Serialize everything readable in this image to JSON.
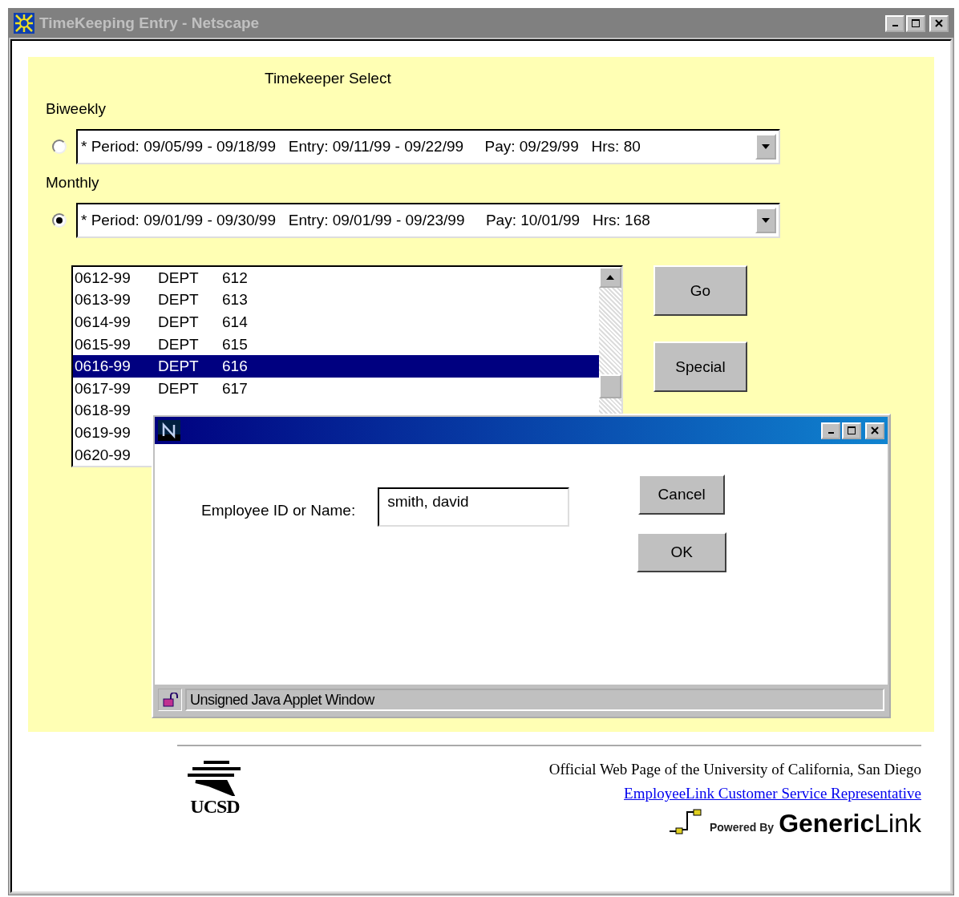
{
  "window": {
    "title": "TimeKeeping Entry - Netscape"
  },
  "page": {
    "heading": "Timekeeper Select",
    "periods": [
      {
        "label": "Biweekly",
        "selected": false,
        "value": "* Period: 09/05/99 - 09/18/99   Entry: 09/11/99 - 09/22/99     Pay: 09/29/99   Hrs: 80"
      },
      {
        "label": "Monthly",
        "selected": true,
        "value": "* Period: 09/01/99 - 09/30/99   Entry: 09/01/99 - 09/23/99     Pay: 10/01/99   Hrs: 168"
      }
    ],
    "departments": [
      {
        "code": "0612-99",
        "dept": "DEPT",
        "number": "612",
        "selected": false
      },
      {
        "code": "0613-99",
        "dept": "DEPT",
        "number": "613",
        "selected": false
      },
      {
        "code": "0614-99",
        "dept": "DEPT",
        "number": "614",
        "selected": false
      },
      {
        "code": "0615-99",
        "dept": "DEPT",
        "number": "615",
        "selected": false
      },
      {
        "code": "0616-99",
        "dept": "DEPT",
        "number": "616",
        "selected": true
      },
      {
        "code": "0617-99",
        "dept": "DEPT",
        "number": "617",
        "selected": false
      },
      {
        "code": "0618-99",
        "selected": false
      },
      {
        "code": "0619-99",
        "selected": false
      },
      {
        "code": "0620-99",
        "selected": false
      }
    ],
    "buttons": [
      "Go",
      "Special"
    ]
  },
  "dialog": {
    "label": "Employee ID or Name:",
    "value": "smith, david",
    "buttons": [
      "Cancel",
      "OK"
    ],
    "status": "Unsigned Java Applet Window"
  },
  "footer": {
    "official": "Official Web Page of the University of California, San Diego",
    "logo": "UCSD",
    "link": "EmployeeLink Customer Service Representative",
    "powered": "Powered By",
    "brand": "**Generic**Link"
  }
}
